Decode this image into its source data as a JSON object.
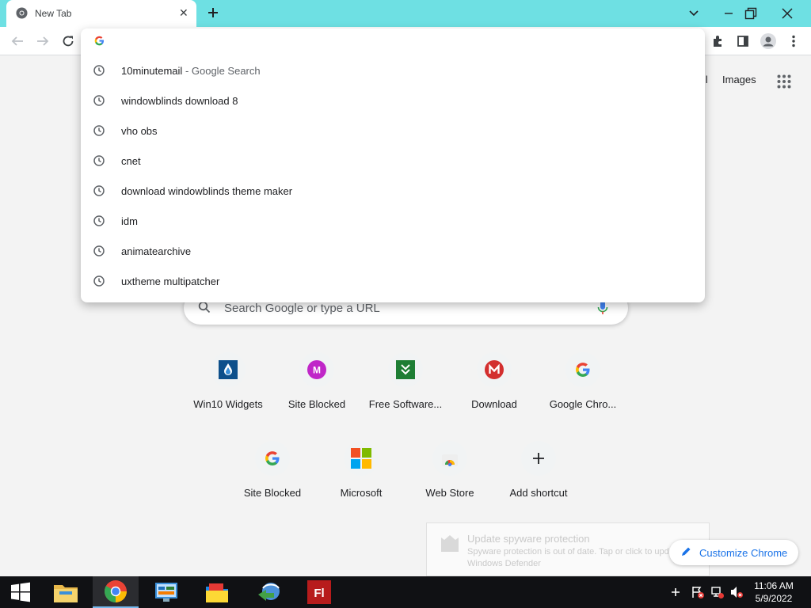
{
  "tab": {
    "title": "New Tab",
    "close_glyph": "✕",
    "new_tab_glyph": "+"
  },
  "toolbar": {
    "icons": [
      "back-icon",
      "forward-icon",
      "reload-icon",
      "extensions-icon",
      "side-panel-icon",
      "profile-icon",
      "menu-icon"
    ]
  },
  "omnibox": {
    "input_value": "",
    "suggestions": [
      {
        "query": "10minutemail",
        "suffix": " - Google Search"
      },
      {
        "query": "windowblinds download 8",
        "suffix": ""
      },
      {
        "query": "vho obs",
        "suffix": ""
      },
      {
        "query": "cnet",
        "suffix": ""
      },
      {
        "query": "download windowblinds theme maker",
        "suffix": ""
      },
      {
        "query": "idm",
        "suffix": ""
      },
      {
        "query": "animatearchive",
        "suffix": ""
      },
      {
        "query": "uxtheme multipatcher",
        "suffix": ""
      }
    ]
  },
  "header_links": {
    "gmail_partial": "il",
    "images": "Images"
  },
  "search": {
    "placeholder": "Search Google or type a URL"
  },
  "shortcuts": [
    {
      "label": "Win10 Widgets",
      "icon": "drop-icon",
      "color": "#0d4f8b"
    },
    {
      "label": "Site Blocked",
      "icon": "M",
      "color": "#c026c8"
    },
    {
      "label": "Free Software...",
      "icon": "chevron-icon",
      "color": "#1e7e34"
    },
    {
      "label": "Download",
      "icon": "M",
      "color": "#d32f2f"
    },
    {
      "label": "Google Chro...",
      "icon": "google-g-icon",
      "color": "#4285f4"
    },
    {
      "label": "Site Blocked",
      "icon": "google-g-icon",
      "color": "#4285f4"
    },
    {
      "label": "Microsoft",
      "icon": "microsoft-icon",
      "color": "#f25022"
    },
    {
      "label": "Web Store",
      "icon": "webstore-icon",
      "color": "#ea4335"
    },
    {
      "label": "Add shortcut",
      "icon": "+",
      "color": "#202124"
    }
  ],
  "customize": {
    "label": "Customize Chrome"
  },
  "notification": {
    "title": "Update spyware protection",
    "body": "Spyware protection is out of date. Tap or click to update Windows Defender"
  },
  "taskbar": {
    "time": "11:06 AM",
    "date": "5/9/2022",
    "apps": [
      "start-icon",
      "file-explorer-icon",
      "chrome-icon",
      "control-panel-icon",
      "folder-app-icon",
      "idm-icon",
      "flash-icon"
    ]
  },
  "colors": {
    "titlebar": "#6ee0e3",
    "accent": "#1a73e8",
    "taskbar": "#101114"
  }
}
